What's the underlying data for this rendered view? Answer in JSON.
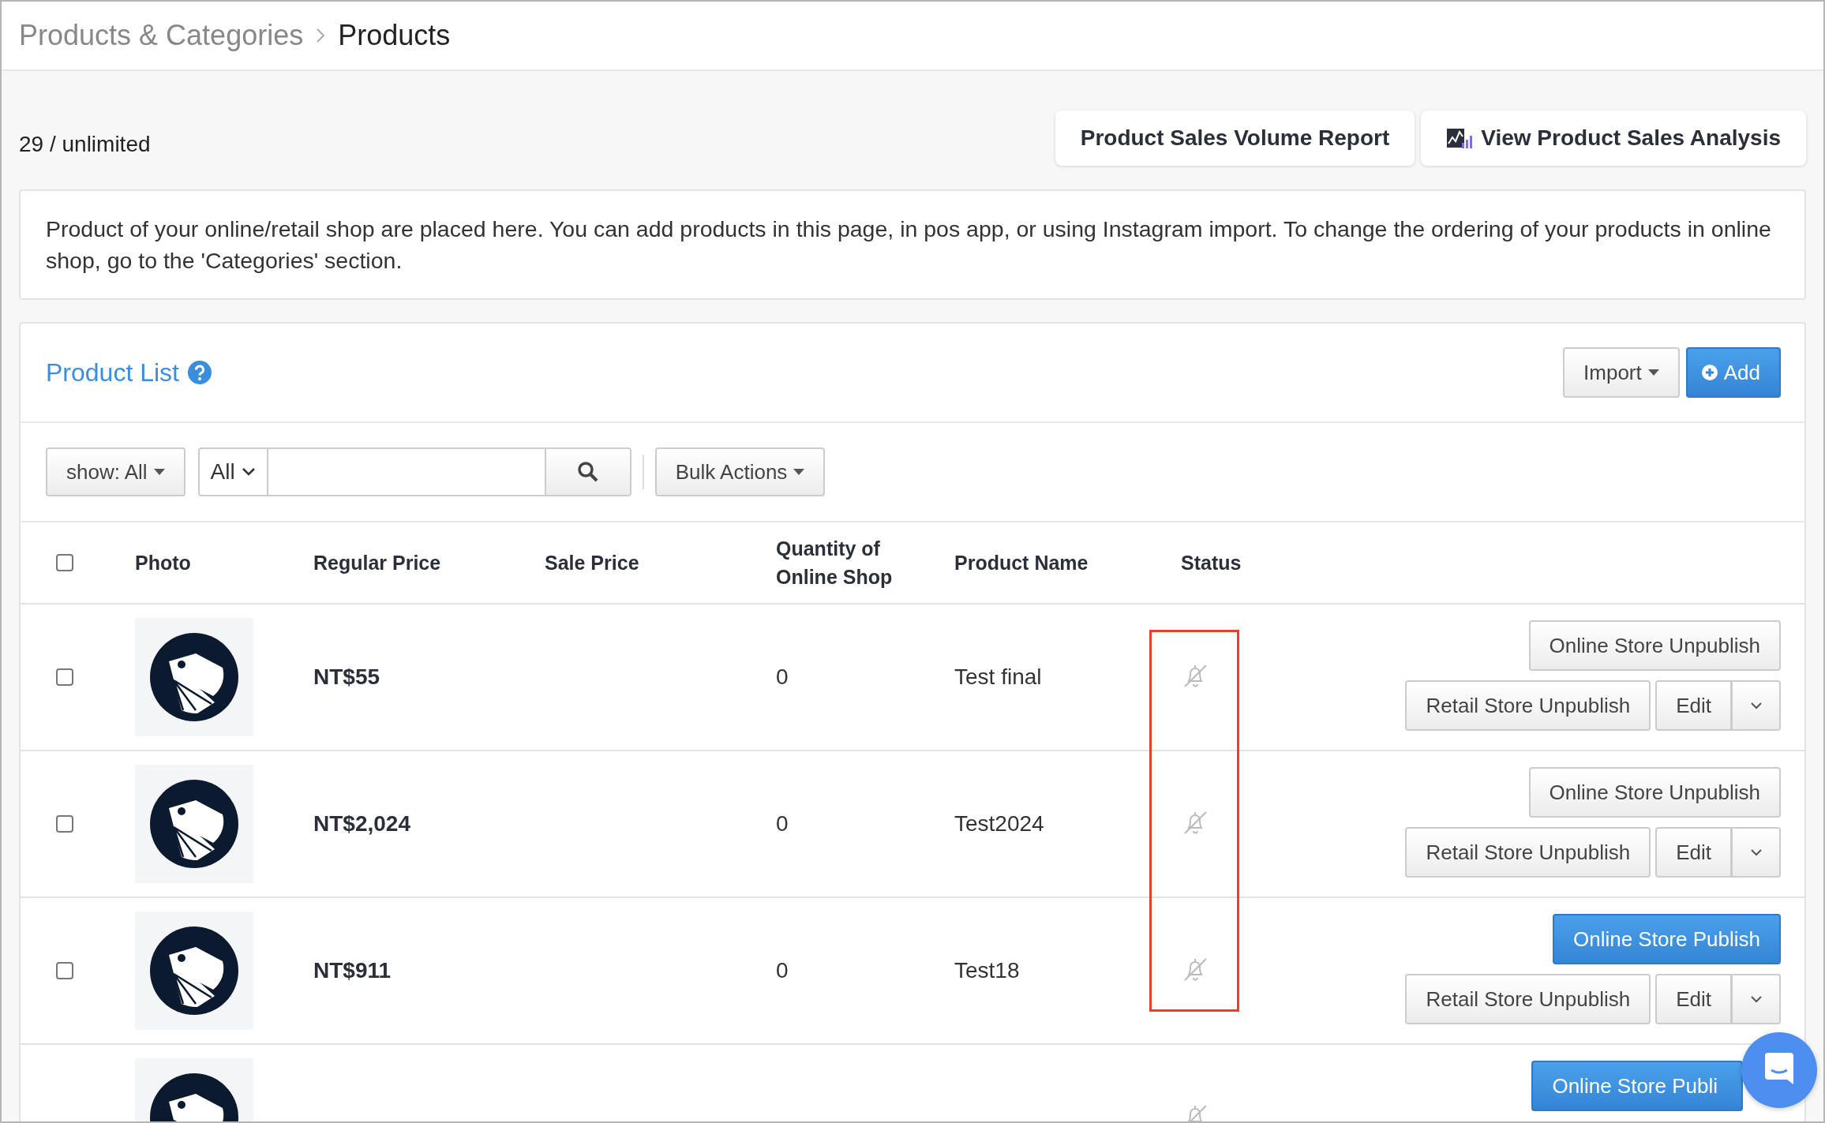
{
  "breadcrumb": {
    "parent": "Products & Categories",
    "current": "Products"
  },
  "count": "29 / unlimited",
  "report_buttons": [
    {
      "label": "Product Sales Volume Report",
      "kind": "plain"
    },
    {
      "label": "View Product Sales Analysis",
      "kind": "chart"
    }
  ],
  "info": "Product of your online/retail shop are placed here. You can add products in this page, in pos app, or using Instagram import. To change the ordering of your products in online shop, go to the 'Categories' section.",
  "product_list": {
    "title": "Product List",
    "import_button": "Import",
    "add_button": "Add"
  },
  "toolbar": {
    "show_filter": "show: All",
    "search_scope": "All",
    "bulk_actions": "Bulk Actions"
  },
  "table": {
    "select_all_checked": false,
    "columns": [
      "Photo",
      "Regular Price",
      "Sale Price",
      "Quantity of Online Shop",
      "Product Name",
      "Status"
    ],
    "rows": [
      {
        "checked": false,
        "regular_price": "NT$55",
        "quantity": "0",
        "name": "Test final",
        "online_button": {
          "label": "Online Store Unpublish",
          "kind": "unpublish"
        },
        "retail_button": "Retail Store Unpublish",
        "edit_button": "Edit"
      },
      {
        "checked": false,
        "regular_price": "NT$2,024",
        "quantity": "0",
        "name": "Test2024",
        "online_button": {
          "label": "Online Store Unpublish",
          "kind": "unpublish"
        },
        "retail_button": "Retail Store Unpublish",
        "edit_button": "Edit"
      },
      {
        "checked": false,
        "regular_price": "NT$911",
        "quantity": "0",
        "name": "Test18",
        "online_button": {
          "label": "Online Store Publish",
          "kind": "publish"
        },
        "retail_button": "Retail Store Unpublish",
        "edit_button": "Edit"
      },
      {
        "online_button": {
          "label": "Online Store Publi",
          "kind": "publish"
        }
      }
    ]
  }
}
